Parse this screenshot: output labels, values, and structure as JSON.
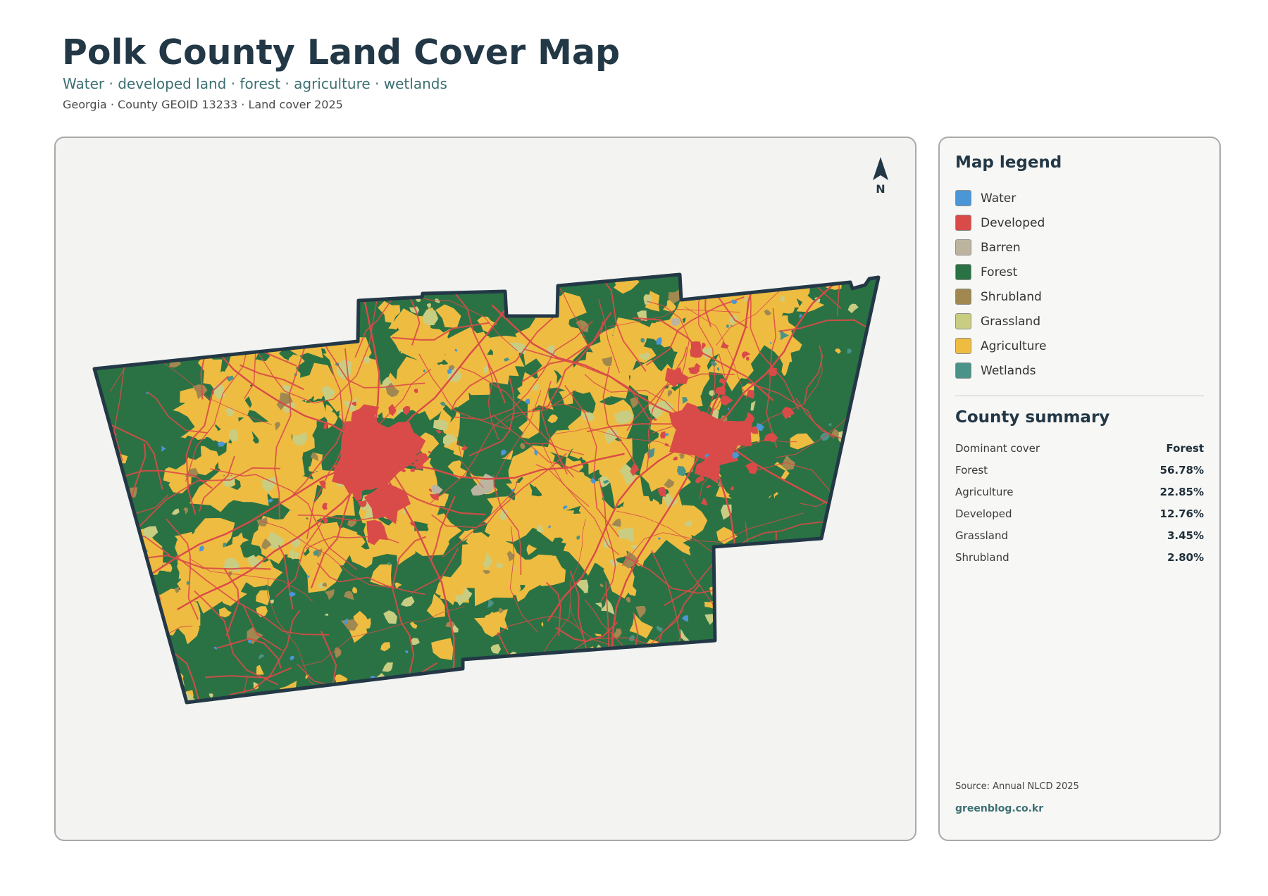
{
  "header": {
    "title": "Polk County Land Cover Map",
    "subtitle": "Water · developed land · forest · agriculture · wetlands",
    "meta": "Georgia · County GEOID 13233 · Land cover 2025"
  },
  "map": {
    "north_label": "N",
    "colors": {
      "boundary": "#233846",
      "road": "#d94b48"
    }
  },
  "legend": {
    "title": "Map legend",
    "items": [
      {
        "label": "Water",
        "color": "#4a96d6"
      },
      {
        "label": "Developed",
        "color": "#d94b48"
      },
      {
        "label": "Barren",
        "color": "#bdb4a0"
      },
      {
        "label": "Forest",
        "color": "#2a7244"
      },
      {
        "label": "Shrubland",
        "color": "#a08850"
      },
      {
        "label": "Grassland",
        "color": "#c9cd82"
      },
      {
        "label": "Agriculture",
        "color": "#efbc42"
      },
      {
        "label": "Wetlands",
        "color": "#4a9388"
      }
    ]
  },
  "summary": {
    "title": "County summary",
    "rows": [
      {
        "key": "Dominant cover",
        "value": "Forest"
      },
      {
        "key": "Forest",
        "value": "56.78%"
      },
      {
        "key": "Agriculture",
        "value": "22.85%"
      },
      {
        "key": "Developed",
        "value": "12.76%"
      },
      {
        "key": "Grassland",
        "value": "3.45%"
      },
      {
        "key": "Shrubland",
        "value": "2.80%"
      }
    ]
  },
  "footer": {
    "source": "Source: Annual NLCD 2025",
    "site": "greenblog.co.kr"
  }
}
